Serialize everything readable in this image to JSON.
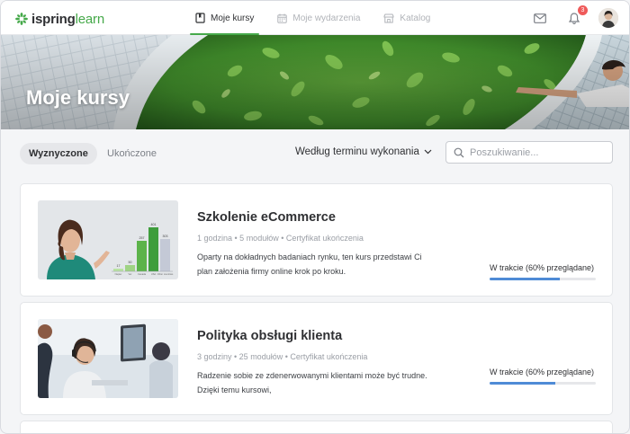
{
  "brand": {
    "name_part1": "ispring",
    "name_part2": "learn",
    "green": "#46a94a"
  },
  "nav": {
    "items": [
      {
        "label": "Moje kursy",
        "icon": "book-icon",
        "active": true
      },
      {
        "label": "Moje wydarzenia",
        "icon": "calendar-icon",
        "active": false
      },
      {
        "label": "Katalog",
        "icon": "store-icon",
        "active": false
      }
    ],
    "notifications_count": "3"
  },
  "hero": {
    "title": "Moje kursy"
  },
  "filters": {
    "tab_assigned": "Wyznyczone",
    "tab_completed": "Ukończone",
    "sort_label": "Według terminu wykonania",
    "search_placeholder": "Poszukiwanie..."
  },
  "courses": [
    {
      "title": "Szkolenie eCommerce",
      "meta": "1 godzina  •  5 modułów  •  Certyfikat ukończenia",
      "description": "Oparty na dokładnych badaniach rynku, ten kurs przedstawi Ci plan założenia firmy online krok po kroku.",
      "status": "W trakcie (60% przeglądane)",
      "progress": 0.66,
      "chart": {
        "values": [
          "17",
          "50",
          "257",
          "401",
          "303"
        ],
        "labels": [
          "Napier",
          "Ver",
          "Canada",
          "USA",
          "Other countries"
        ]
      }
    },
    {
      "title": "Polityka obsługi klienta",
      "meta": "3  godziny  •  25 modułów  •  Certyfikat ukończenia",
      "description": "Radzenie sobie ze zdenerwowanymi klientami może być trudne. Dzięki temu kursowi,",
      "status": "W trakcie (60% przeglądane)",
      "progress": 0.62
    }
  ]
}
